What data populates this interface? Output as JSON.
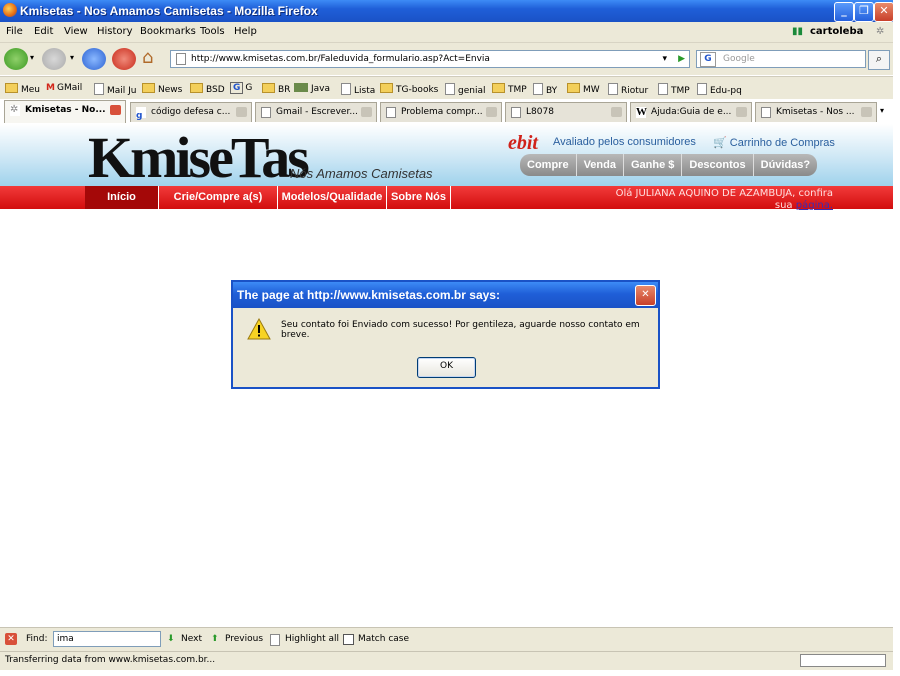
{
  "window": {
    "title": "Kmisetas - Nos Amamos Camisetas - Mozilla Firefox"
  },
  "menu": [
    "File",
    "Edit",
    "View",
    "History",
    "Bookmarks",
    "Tools",
    "Help"
  ],
  "user": "cartoleba",
  "address": {
    "url": "http://www.kmisetas.com.br/Faleduvida_formulario.asp?Act=Envia"
  },
  "search": {
    "placeholder": "Google"
  },
  "bookmarks": [
    "Meu",
    "GMail",
    "Mail Ju",
    "News",
    "BSD",
    "G",
    "BR",
    "Java",
    "Lista",
    "TG-books",
    "genial",
    "TMP",
    "BY",
    "MW",
    "Riotur",
    "TMP",
    "Edu-pq"
  ],
  "tabs": [
    "Kmisetas - No...",
    "código defesa c...",
    "Gmail - Escrever...",
    "Problema compr...",
    "L8078",
    "Ajuda:Guia de e...",
    "Kmisetas - Nos ..."
  ],
  "site": {
    "logo": "KmiseTas",
    "slogan": "Nós Amamos Camisetas",
    "ebit_logo": "ebit",
    "ebit_text": "Avaliado pelos consumidores",
    "cart": "Carrinho de Compras",
    "pills": [
      "Compre",
      "Venda",
      "Ganhe $",
      "Descontos",
      "Dúvidas?"
    ],
    "nav": [
      "Início",
      "Crie/Compre a(s) Sua(s)!",
      "Modelos/Qualidade",
      "Sobre Nós"
    ],
    "greeting_line1": "Olá JULIANA AQUINO DE AZAMBUJA, confira",
    "greeting_line2": "sua",
    "greeting_link": "página."
  },
  "dialog": {
    "title": "The page at http://www.kmisetas.com.br says:",
    "message": "Seu contato foi Enviado com sucesso! Por gentileza, aguarde nosso contato em breve.",
    "ok": "OK"
  },
  "findbar": {
    "label": "Find:",
    "value": "ima",
    "next": "Next",
    "previous": "Previous",
    "highlight": "Highlight all",
    "matchcase": "Match case"
  },
  "status": "Transferring data from www.kmisetas.com.br..."
}
